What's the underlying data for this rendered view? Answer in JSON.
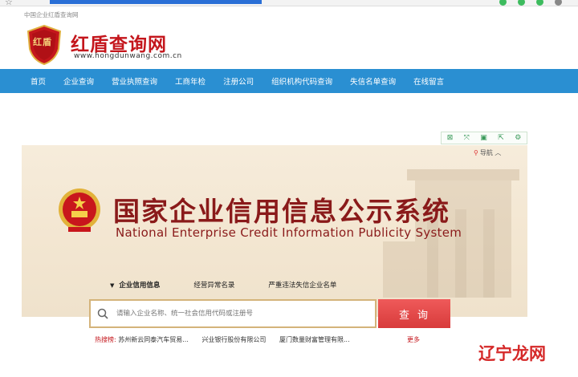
{
  "top_text": "中国企业红盾查询网",
  "logo": {
    "title": "红盾查询网",
    "url": "www.hongdunwang.com.cn",
    "shield_text": "红盾"
  },
  "nav": [
    "首页",
    "企业查询",
    "营业执照查询",
    "工商年检",
    "注册公司",
    "组织机构代码查询",
    "失信名单查询",
    "在线留言"
  ],
  "banner": {
    "nav_label": "导航",
    "title_cn": "国家企业信用信息公示系统",
    "title_en": "National Enterprise Credit Information Publicity System",
    "tabs": [
      "企业信用信息",
      "经营异常名录",
      "严重违法失信企业名单"
    ],
    "search_placeholder": "请输入企业名称、统一社会信用代码或注册号",
    "search_button": "查询",
    "hot_label": "热搜榜:",
    "hot_items": [
      "苏州新云同泰汽车贸易...",
      "兴业银行股份有限公司",
      "厦门数量财富管理有限..."
    ],
    "more": "更多"
  },
  "watermark": {
    "text": "辽宁龙网"
  },
  "colors": {
    "brand_red": "#c4161c",
    "nav_blue": "#2a8fd2",
    "title_brown": "#8a1a1a"
  }
}
